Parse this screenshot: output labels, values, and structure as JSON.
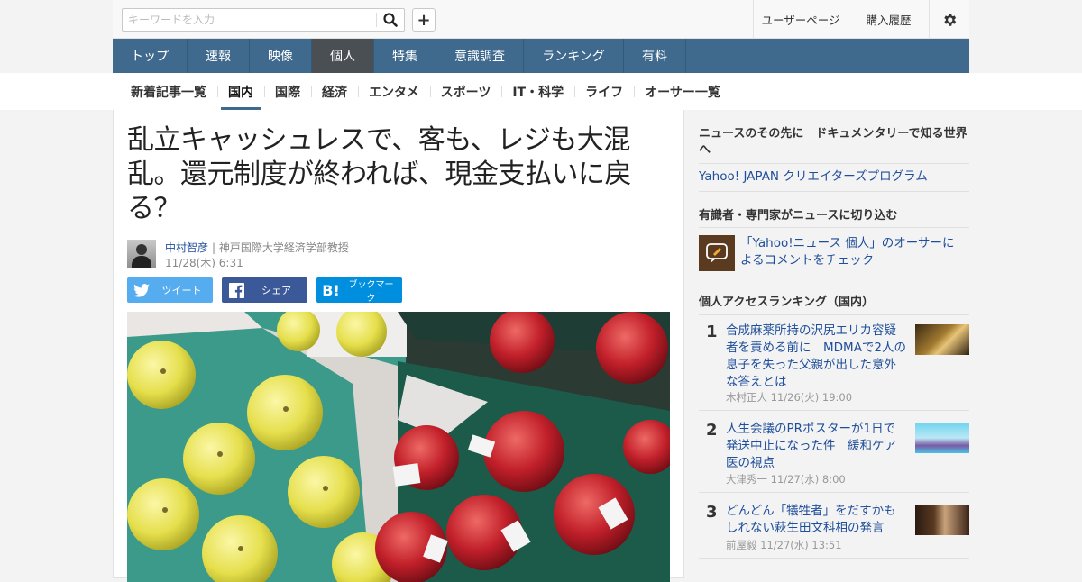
{
  "search": {
    "placeholder": "キーワードを入力"
  },
  "toplinks": {
    "user_page": "ユーザーページ",
    "purchase_history": "購入履歴"
  },
  "main_nav": [
    "トップ",
    "速報",
    "映像",
    "個人",
    "特集",
    "意識調査",
    "ランキング",
    "有料"
  ],
  "main_nav_active": "個人",
  "sub_nav": [
    "新着記事一覧",
    "国内",
    "国際",
    "経済",
    "エンタメ",
    "スポーツ",
    "IT・科学",
    "ライフ",
    "オーサー一覧"
  ],
  "sub_nav_active": "国内",
  "article": {
    "title_lines": [
      "乱立キャッシュレスで、客も、レジも大混",
      "乱。還元制度が終われば、現金支払いに戻",
      "る？"
    ],
    "author_name": "中村智彦",
    "author_title": "| 神戸国際大学経済学部教授",
    "date": "11/28(木) 6:31",
    "share": {
      "tweet": "ツイート",
      "facebook": "シェア",
      "hatena": "ブックマーク"
    }
  },
  "sidebar": {
    "promo_title": "ニュースのその先に　ドキュメンタリーで知る世界へ",
    "promo_link": "Yahoo! JAPAN クリエイターズプログラム",
    "expert_title": "有識者・専門家がニュースに切り込む",
    "expert_link": "「Yahoo!ニュース 個人」のオーサーによるコメントをチェック",
    "ranking_title": "個人アクセスランキング（国内）",
    "ranking": [
      {
        "rank": "1",
        "title": "合成麻薬所持の沢尻エリカ容疑者を責める前に　MDMAで2人の息子を失った父親が出した意外な答えとは",
        "author": "木村正人",
        "date": "11/26(火) 19:00"
      },
      {
        "rank": "2",
        "title": "人生会議のPRポスターが1日で発送中止になった件　緩和ケア医の視点",
        "author": "大津秀一",
        "date": "11/27(水) 8:00"
      },
      {
        "rank": "3",
        "title": "どんどん「犠牲者」をだすかもしれない萩生田文科相の発言",
        "author": "前屋毅",
        "date": "11/27(水) 13:51"
      }
    ]
  },
  "colors": {
    "nav": "#3f6a8e",
    "nav_active": "#4a4f54",
    "link": "#1f4e9a",
    "twitter": "#55acee",
    "facebook": "#3b5998",
    "hatena": "#008fde"
  }
}
